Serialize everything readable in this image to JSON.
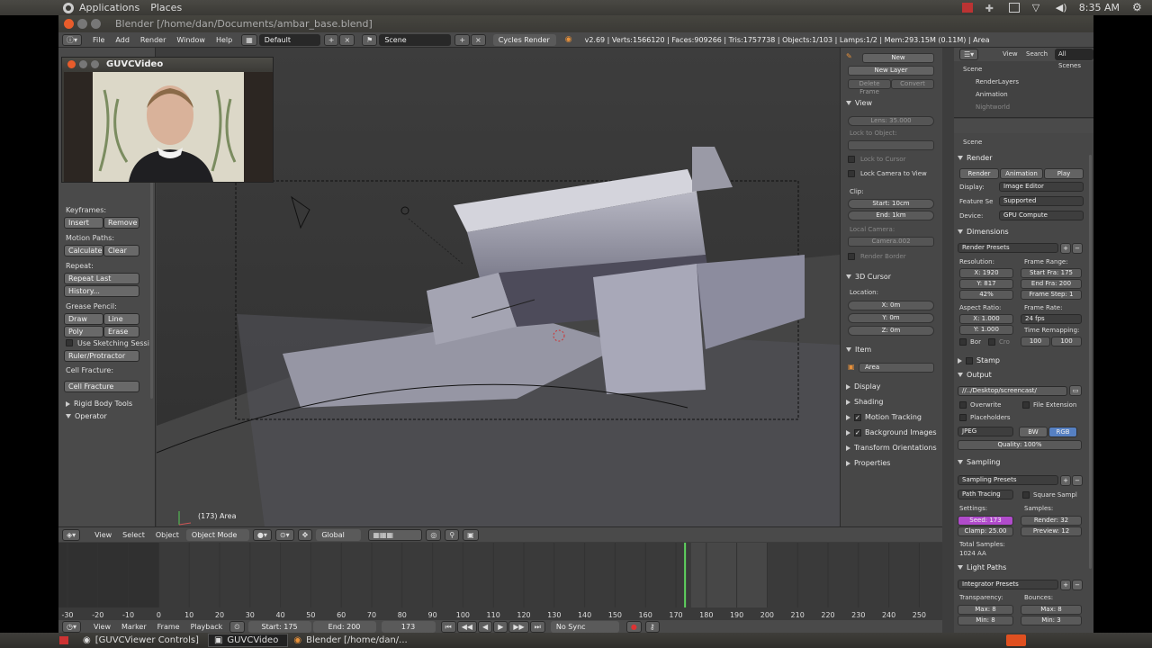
{
  "system_panel": {
    "menus": [
      "Applications",
      "Places"
    ],
    "clock": "8:35 AM"
  },
  "window": {
    "title": "Blender [/home/dan/Documents/ambar_base.blend]"
  },
  "info_header": {
    "menus": [
      "File",
      "Add",
      "Render",
      "Window",
      "Help"
    ],
    "screen_layout": "Default",
    "scene": "Scene",
    "render_engine": "Cycles Render",
    "stats": "v2.69 | Verts:1566120 | Faces:909266 | Tris:1757738 | Objects:1/103 | Lamps:1/2 | Mem:293.15M (0.11M) | Area"
  },
  "webcam": {
    "title": "GUVCVideo"
  },
  "toolshelf": {
    "keyframes_label": "Keyframes:",
    "insert": "Insert",
    "remove": "Remove",
    "motion_paths_label": "Motion Paths:",
    "calculate": "Calculate",
    "clear": "Clear",
    "repeat_label": "Repeat:",
    "repeat_last": "Repeat Last",
    "history": "History...",
    "grease_pencil_label": "Grease Pencil:",
    "draw": "Draw",
    "line": "Line",
    "poly": "Poly",
    "erase": "Erase",
    "use_sketching": "Use Sketching Sessi",
    "ruler": "Ruler/Protractor",
    "cell_fracture_label": "Cell Fracture:",
    "cell_fracture_btn": "Cell Fracture",
    "rigid_body_tools": "Rigid Body Tools",
    "operator": "Operator"
  },
  "viewport": {
    "object_label": "(173) Area"
  },
  "npanel": {
    "new_btn": "New",
    "new_layer": "New Layer",
    "delete_frame": "Delete Frame",
    "convert": "Convert",
    "view_header": "View",
    "lens": "Lens: 35.000",
    "lock_to_object": "Lock to Object:",
    "lock_to_cursor": "Lock to Cursor",
    "lock_camera_to_view": "Lock Camera to View",
    "clip_label": "Clip:",
    "clip_start": "Start: 10cm",
    "clip_end": "End: 1km",
    "local_camera_label": "Local Camera:",
    "local_camera": "Camera.002",
    "render_border": "Render Border",
    "cursor_header": "3D Cursor",
    "location_label": "Location:",
    "x": "X: 0m",
    "y": "Y: 0m",
    "z": "Z: 0m",
    "item_header": "Item",
    "item_name": "Area",
    "display": "Display",
    "shading": "Shading",
    "motion_tracking": "Motion Tracking",
    "background_images": "Background Images",
    "transform_orientations": "Transform Orientations",
    "properties": "Properties"
  },
  "outliner": {
    "menus": [
      "View",
      "Search"
    ],
    "filter": "All Scenes",
    "items": [
      "Scene",
      "RenderLayers",
      "Animation",
      "Nightworld"
    ]
  },
  "props": {
    "scene_label": "Scene",
    "render_header": "Render",
    "render_btn": "Render",
    "animation_btn": "Animation",
    "play_btn": "Play",
    "display_label": "Display:",
    "display_val": "Image Editor",
    "feature_set_label": "Feature Se",
    "feature_set_val": "Supported",
    "device_label": "Device:",
    "device_val": "GPU Compute",
    "dimensions_header": "Dimensions",
    "render_presets": "Render Presets",
    "resolution_label": "Resolution:",
    "res_x": "X: 1920",
    "res_y": "Y: 817",
    "res_pct": "42%",
    "frame_range_label": "Frame Range:",
    "start_frame": "Start Fra: 175",
    "end_frame": "End Fra: 200",
    "frame_step": "Frame Step: 1",
    "aspect_label": "Aspect Ratio:",
    "aspect_x": "X: 1.000",
    "aspect_y": "Y: 1.000",
    "frame_rate_label": "Frame Rate:",
    "frame_rate": "24 fps",
    "time_remap_label": "Time Remapping:",
    "remap_old": "100",
    "remap_new": "100",
    "bor": "Bor",
    "cro": "Cro",
    "stamp_header": "Stamp",
    "output_header": "Output",
    "output_path": "//../Desktop/screencast/",
    "overwrite": "Overwrite",
    "file_extension": "File Extension",
    "placeholders": "Placeholders",
    "format": "JPEG",
    "bw": "BW",
    "rgb": "RGB",
    "quality": "Quality: 100%",
    "sampling_header": "Sampling",
    "sampling_presets": "Sampling Presets",
    "path_tracing": "Path Tracing",
    "square_samples": "Square Sampl",
    "settings_label": "Settings:",
    "samples_label": "Samples:",
    "seed": "Seed: 173",
    "clamp": "Clamp: 25.00",
    "render_samples": "Render: 32",
    "preview_samples": "Preview: 12",
    "total_samples_label": "Total Samples:",
    "total_samples": "1024 AA",
    "light_paths_header": "Light Paths",
    "integrator_presets": "Integrator Presets",
    "transparency_label": "Transparency:",
    "bounces_label": "Bounces:",
    "trans_max": "Max: 8",
    "bounce_max": "Max: 8",
    "trans_min": "Min: 8",
    "bounce_min": "Min: 3"
  },
  "view_header": {
    "menus": [
      "View",
      "Select",
      "Object"
    ],
    "mode": "Object Mode",
    "orientation": "Global"
  },
  "timeline": {
    "ticks": [
      "-30",
      "-20",
      "-10",
      "0",
      "10",
      "20",
      "30",
      "40",
      "50",
      "60",
      "70",
      "80",
      "90",
      "100",
      "110",
      "120",
      "130",
      "140",
      "150",
      "160",
      "170",
      "180",
      "190",
      "200",
      "210",
      "220",
      "230",
      "240",
      "250"
    ],
    "current_frame": 173,
    "start": "Start: 175",
    "end": "End: 200",
    "frame": "173",
    "sync": "No Sync",
    "menus": [
      "View",
      "Marker",
      "Frame",
      "Playback"
    ]
  },
  "taskbar": {
    "tasks": [
      "[GUVCViewer Controls]",
      "GUVCVideo",
      "Blender [/home/dan/..."
    ]
  }
}
